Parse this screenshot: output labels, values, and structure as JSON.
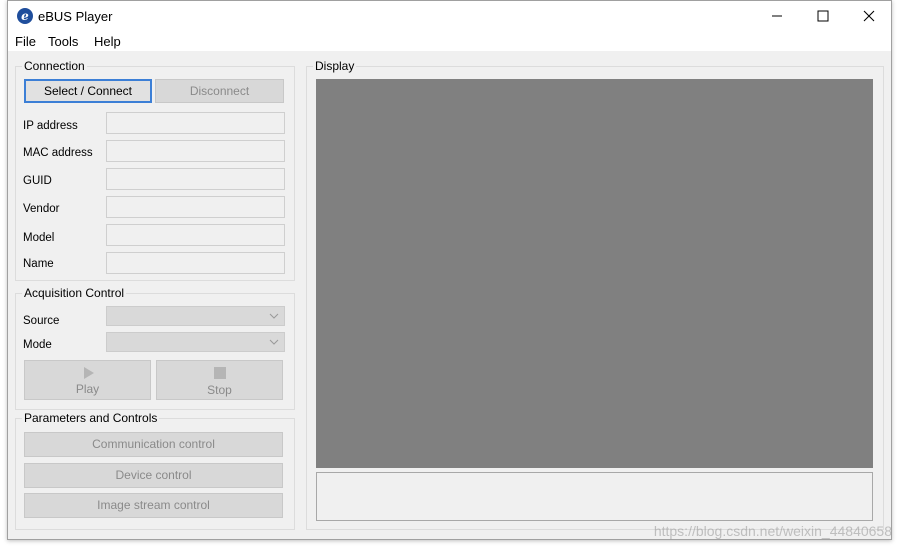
{
  "window": {
    "title": "eBUS Player",
    "logo_letter": "e"
  },
  "menu": {
    "items": [
      "File",
      "Tools",
      "Help"
    ]
  },
  "connection": {
    "title": "Connection",
    "select_connect": "Select / Connect",
    "disconnect": "Disconnect",
    "fields": [
      {
        "label": "IP address",
        "value": ""
      },
      {
        "label": "MAC address",
        "value": ""
      },
      {
        "label": "GUID",
        "value": ""
      },
      {
        "label": "Vendor",
        "value": ""
      },
      {
        "label": "Model",
        "value": ""
      },
      {
        "label": "Name",
        "value": ""
      }
    ]
  },
  "acquisition": {
    "title": "Acquisition Control",
    "source_label": "Source",
    "source_value": "",
    "mode_label": "Mode",
    "mode_value": "",
    "play": "Play",
    "stop": "Stop"
  },
  "parameters": {
    "title": "Parameters and Controls",
    "buttons": [
      "Communication control",
      "Device control",
      "Image stream control"
    ]
  },
  "display": {
    "title": "Display"
  },
  "watermark": "https://blog.csdn.net/weixin_44840658"
}
